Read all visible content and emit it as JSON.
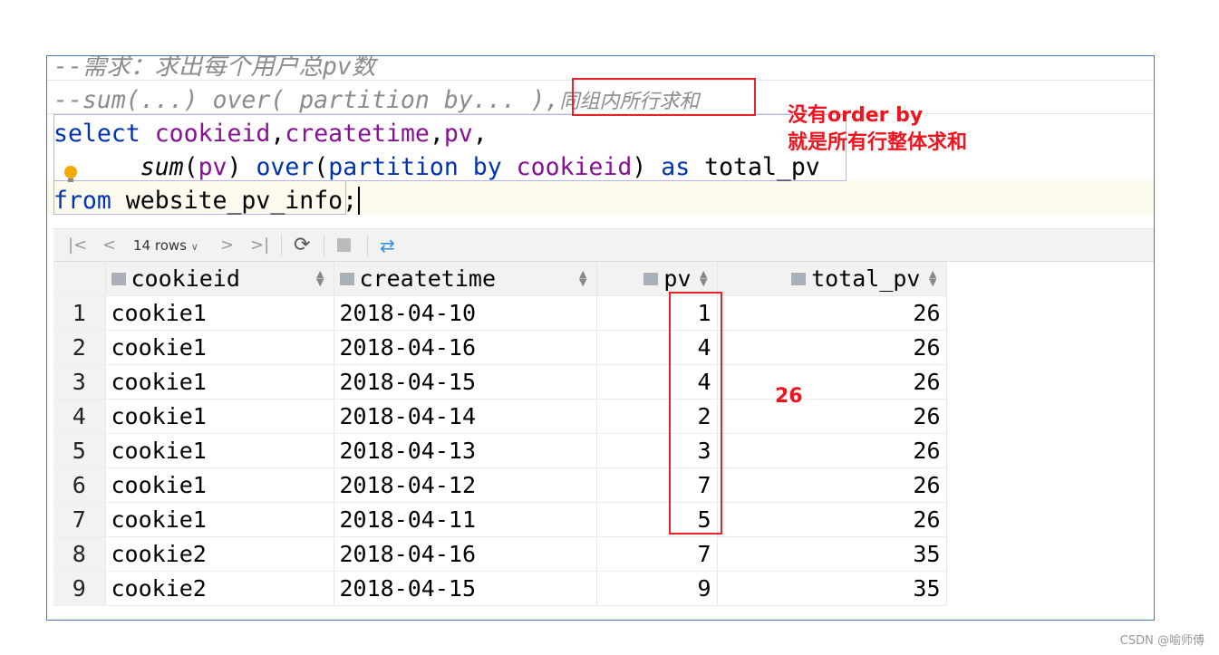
{
  "editor": {
    "comment1": "--需求：求出每个用户总pv数",
    "comment2_a": "--sum(...) over( partition by... ),",
    "comment2_b": "同组内所行求和",
    "line3": {
      "kw": "select",
      "c1": "cookieid",
      "c2": "createtime",
      "c3": "pv",
      "comma": ","
    },
    "line4": {
      "indent": "      ",
      "fn": "sum",
      "open": "(",
      "arg": "pv",
      "close": ")",
      "over": "over",
      "paren": "(",
      "partition": "partition by",
      "col": "cookieid",
      "end": ")",
      "as": "as",
      "alias": "total_pv"
    },
    "line5": {
      "kw": "from",
      "table": "website_pv_info",
      "semi": ";"
    }
  },
  "annotations": {
    "note_line1": "没有order by",
    "note_line2": "就是所有行整体求和",
    "sum_label": "26",
    "highlight_color": "#e8232a"
  },
  "toolbar": {
    "rows_label": "14 rows"
  },
  "table": {
    "columns": [
      "cookieid",
      "createtime",
      "pv",
      "total_pv"
    ],
    "rows": [
      [
        "1",
        "cookie1",
        "2018-04-10",
        "1",
        "26"
      ],
      [
        "2",
        "cookie1",
        "2018-04-16",
        "4",
        "26"
      ],
      [
        "3",
        "cookie1",
        "2018-04-15",
        "4",
        "26"
      ],
      [
        "4",
        "cookie1",
        "2018-04-14",
        "2",
        "26"
      ],
      [
        "5",
        "cookie1",
        "2018-04-13",
        "3",
        "26"
      ],
      [
        "6",
        "cookie1",
        "2018-04-12",
        "7",
        "26"
      ],
      [
        "7",
        "cookie1",
        "2018-04-11",
        "5",
        "26"
      ],
      [
        "8",
        "cookie2",
        "2018-04-16",
        "7",
        "35"
      ],
      [
        "9",
        "cookie2",
        "2018-04-15",
        "9",
        "35"
      ]
    ]
  },
  "watermark": "CSDN @喻师傅"
}
